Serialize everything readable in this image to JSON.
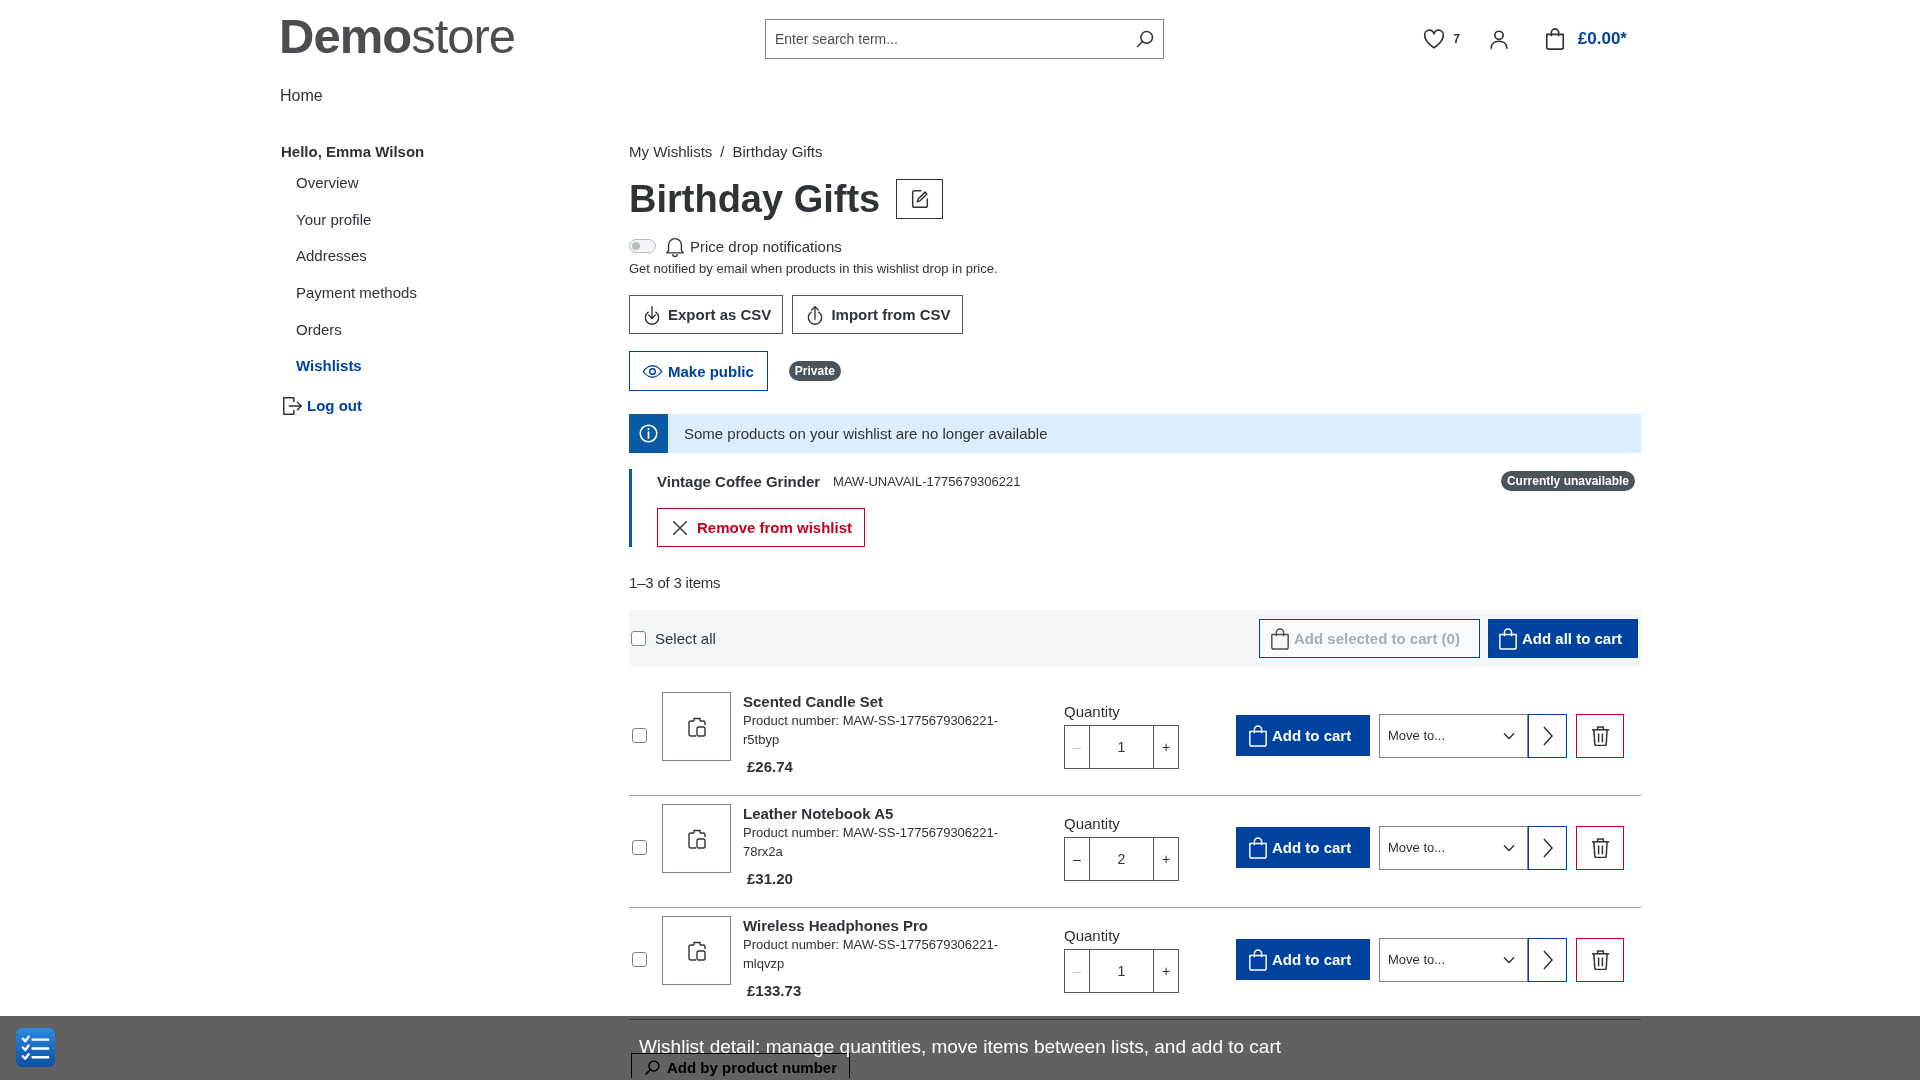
{
  "header": {
    "logo": "**Demo**store",
    "search": {
      "placeholder": "Enter search term..."
    },
    "wishlist_count": "7",
    "cart_total": "£0.00*"
  },
  "nav": {
    "items": [
      {
        "label": "Home"
      }
    ]
  },
  "sidebar": {
    "greeting": "Hello, Emma Wilson",
    "items": [
      {
        "label": "Overview",
        "selected": false
      },
      {
        "label": "Your profile",
        "selected": false
      },
      {
        "label": "Addresses",
        "selected": false
      },
      {
        "label": "Payment methods",
        "selected": false
      },
      {
        "label": "Orders",
        "selected": false
      },
      {
        "label": "Wishlists",
        "selected": true
      }
    ],
    "logout": "Log out"
  },
  "breadcrumb": {
    "items": [
      {
        "label": "My Wishlists"
      },
      {
        "label": "Birthday Gifts"
      }
    ],
    "separator": "/"
  },
  "title": "Birthday Gifts",
  "price_notifications": {
    "label": "Price drop notifications",
    "on": false,
    "description": "Get notified by email when products in this wishlist drop in price."
  },
  "actions": [
    {
      "label": "Export as CSV",
      "kind": "export"
    },
    {
      "label": "Import from CSV",
      "kind": "import"
    }
  ],
  "visibility": {
    "button": "Make public",
    "badge": "Private"
  },
  "notice": {
    "text": "Some products on your wishlist are no longer available"
  },
  "unavailable_items": [
    {
      "name": "Vintage Coffee Grinder",
      "sku": "MAW-UNAVAIL-1775679306221",
      "badge": "Currently unavailable",
      "remove": "Remove from wishlist"
    }
  ],
  "item_count": "1–3 of 3 items",
  "toolbar": {
    "select_all": {
      "label": "Select all",
      "checked": false
    },
    "add_selected": {
      "label": "Add selected to cart (0)",
      "disabled": true
    },
    "add_all": {
      "label": "Add all to cart"
    }
  },
  "items": [
    {
      "name": "Scented Candle Set",
      "product_number": "Product number: MAW-SS-1775679306221-r5tbyp",
      "price": "£26.74",
      "checked": false,
      "quantity_label": "Quantity",
      "decrease": "–",
      "quantity": "1",
      "increase": "+",
      "decrease_disabled": true,
      "add_to_cart": "Add to cart",
      "move_to": "Move to..."
    },
    {
      "name": "Leather Notebook A5",
      "product_number": "Product number: MAW-SS-1775679306221-78rx2a",
      "price": "£31.20",
      "checked": false,
      "quantity_label": "Quantity",
      "decrease": "–",
      "quantity": "2",
      "increase": "+",
      "decrease_disabled": false,
      "add_to_cart": "Add to cart",
      "move_to": "Move to..."
    },
    {
      "name": "Wireless Headphones Pro",
      "product_number": "Product number: MAW-SS-1775679306221-mlqvzp",
      "price": "£133.73",
      "checked": false,
      "quantity_label": "Quantity",
      "decrease": "–",
      "quantity": "1",
      "increase": "+",
      "decrease_disabled": true,
      "add_to_cart": "Add to cart",
      "move_to": "Move to..."
    }
  ],
  "add_by_number": {
    "label": "Add by product number"
  },
  "caption_bar": {
    "text": "Wishlist detail: manage quantities, move items between lists, and add to cart"
  }
}
